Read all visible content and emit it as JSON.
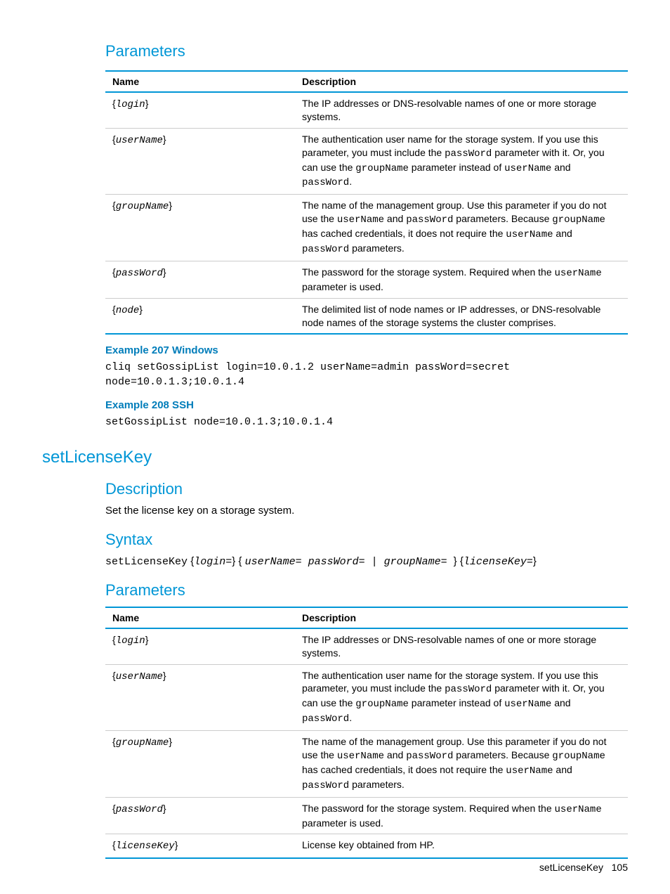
{
  "section1": {
    "heading": "Parameters",
    "table": {
      "headers": [
        "Name",
        "Description"
      ],
      "rows": [
        {
          "name_pre": "{",
          "name_code": "login",
          "name_post": "}",
          "desc_runs": [
            {
              "t": "The IP addresses or DNS-resolvable names of one or more storage systems."
            }
          ]
        },
        {
          "name_pre": "{",
          "name_code": "userName",
          "name_post": "}",
          "desc_runs": [
            {
              "t": "The authentication user name for the storage system. If you use this parameter, you must include the "
            },
            {
              "t": "passWord",
              "code": true
            },
            {
              "t": " parameter with it. Or, you can use the "
            },
            {
              "t": "groupName",
              "code": true
            },
            {
              "t": " parameter instead of "
            },
            {
              "t": "userName",
              "code": true
            },
            {
              "t": " and "
            },
            {
              "t": "passWord",
              "code": true
            },
            {
              "t": "."
            }
          ]
        },
        {
          "name_pre": "{",
          "name_code": "groupName",
          "name_post": "}",
          "desc_runs": [
            {
              "t": "The name of the management group. Use this parameter if you do not use the "
            },
            {
              "t": "userName",
              "code": true
            },
            {
              "t": " and "
            },
            {
              "t": "passWord",
              "code": true
            },
            {
              "t": " parameters. Because "
            },
            {
              "t": "groupName",
              "code": true
            },
            {
              "t": " has cached credentials, it does not require the "
            },
            {
              "t": "userName",
              "code": true
            },
            {
              "t": " and "
            },
            {
              "t": "passWord",
              "code": true
            },
            {
              "t": " parameters."
            }
          ]
        },
        {
          "name_pre": "{",
          "name_code": "passWord",
          "name_post": "}",
          "desc_runs": [
            {
              "t": "The password for the storage system. Required when the "
            },
            {
              "t": "userName",
              "code": true
            },
            {
              "t": " parameter is used."
            }
          ]
        },
        {
          "name_pre": "{",
          "name_code": "node",
          "name_post": "}",
          "desc_runs": [
            {
              "t": "The delimited list of node names or IP addresses, or DNS-resolvable node names of the storage systems the cluster comprises."
            }
          ]
        }
      ]
    }
  },
  "example207": {
    "title": "Example 207 Windows",
    "code": "cliq setGossipList login=10.0.1.2 userName=admin passWord=secret\nnode=10.0.1.3;10.0.1.4"
  },
  "example208": {
    "title": "Example 208 SSH",
    "code": "setGossipList node=10.0.1.3;10.0.1.4"
  },
  "command": {
    "name": "setLicenseKey",
    "description": {
      "heading": "Description",
      "text": "Set the license key on a storage system."
    },
    "syntax": {
      "heading": "Syntax",
      "runs": [
        {
          "t": "setLicenseKey",
          "code": true
        },
        {
          "t": " {"
        },
        {
          "t": "login=",
          "code": true,
          "italic": true
        },
        {
          "t": "} { "
        },
        {
          "t": "userName= passWord= ",
          "code": true,
          "italic": true
        },
        {
          "t": "|",
          "code": true
        },
        {
          "t": " groupName= ",
          "code": true,
          "italic": true
        },
        {
          "t": "} {"
        },
        {
          "t": "licenseKey=",
          "code": true,
          "italic": true
        },
        {
          "t": "}"
        }
      ]
    }
  },
  "section2": {
    "heading": "Parameters",
    "table": {
      "headers": [
        "Name",
        "Description"
      ],
      "rows": [
        {
          "name_pre": "{",
          "name_code": "login",
          "name_post": "}",
          "desc_runs": [
            {
              "t": "The IP addresses or DNS-resolvable names of one or more storage systems."
            }
          ]
        },
        {
          "name_pre": "{",
          "name_code": "userName",
          "name_post": "}",
          "desc_runs": [
            {
              "t": "The authentication user name for the storage system. If you use this parameter, you must include the "
            },
            {
              "t": "passWord",
              "code": true
            },
            {
              "t": " parameter with it. Or, you can use the "
            },
            {
              "t": "groupName",
              "code": true
            },
            {
              "t": " parameter instead of "
            },
            {
              "t": "userName",
              "code": true
            },
            {
              "t": " and "
            },
            {
              "t": "passWord",
              "code": true
            },
            {
              "t": "."
            }
          ]
        },
        {
          "name_pre": "{",
          "name_code": "groupName",
          "name_post": "}",
          "desc_runs": [
            {
              "t": "The name of the management group. Use this parameter if you do not use the "
            },
            {
              "t": "userName",
              "code": true
            },
            {
              "t": " and "
            },
            {
              "t": "passWord",
              "code": true
            },
            {
              "t": " parameters. Because "
            },
            {
              "t": "groupName",
              "code": true
            },
            {
              "t": " has cached credentials, it does not require the "
            },
            {
              "t": "userName",
              "code": true
            },
            {
              "t": " and "
            },
            {
              "t": "passWord",
              "code": true
            },
            {
              "t": " parameters."
            }
          ]
        },
        {
          "name_pre": "{",
          "name_code": "passWord",
          "name_post": "}",
          "desc_runs": [
            {
              "t": "The password for the storage system. Required when the "
            },
            {
              "t": "userName",
              "code": true
            },
            {
              "t": " parameter is used."
            }
          ]
        },
        {
          "name_pre": "{",
          "name_code": "licenseKey",
          "name_post": "}",
          "desc_runs": [
            {
              "t": "License key obtained from HP."
            }
          ]
        }
      ]
    }
  },
  "footer": {
    "text": "setLicenseKey",
    "page": "105"
  }
}
